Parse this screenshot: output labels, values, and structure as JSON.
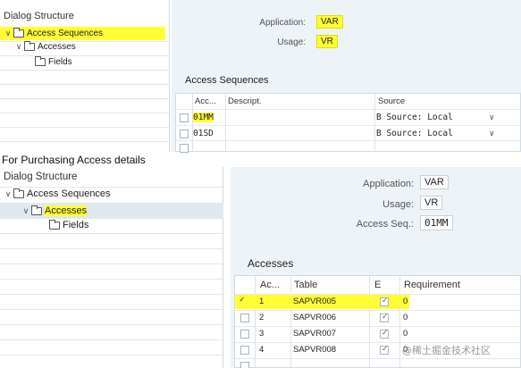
{
  "top": {
    "tree": {
      "header": "Dialog Structure",
      "nodes": [
        "Access Sequences",
        "Accesses",
        "Fields"
      ]
    },
    "fields": [
      {
        "label": "Application:",
        "value": "VAR"
      },
      {
        "label": "Usage:",
        "value": "VR"
      }
    ],
    "section_title": "Access Sequences",
    "columns": [
      "Acc...",
      "Descript.",
      "Source"
    ],
    "rows": [
      {
        "acc": "01MM",
        "desc": "",
        "source": "B Source: Local"
      },
      {
        "acc": "01SD",
        "desc": "",
        "source": "B Source: Local"
      }
    ]
  },
  "caption": "For Purchasing Access details",
  "bottom": {
    "tree": {
      "header": "Dialog Structure",
      "nodes": [
        "Access Sequences",
        "Accesses",
        "Fields"
      ]
    },
    "fields": [
      {
        "label": "Application:",
        "value": "VAR"
      },
      {
        "label": "Usage:",
        "value": "VR"
      },
      {
        "label": "Access Seq.:",
        "value": "01MM"
      }
    ],
    "section_title": "Accesses",
    "columns": [
      "Ac...",
      "Table",
      "E",
      "Requirement"
    ],
    "rows": [
      {
        "acc": "1",
        "table": "SAPVR005",
        "req": "0"
      },
      {
        "acc": "2",
        "table": "SAPVR006",
        "req": "0"
      },
      {
        "acc": "3",
        "table": "SAPVR007",
        "req": "0"
      },
      {
        "acc": "4",
        "table": "SAPVR008",
        "req": "0"
      }
    ]
  },
  "watermark": "@稀土掘金技术社区",
  "colors": {
    "highlight": "#ffff33",
    "panel_bg": "#eef3f7"
  }
}
